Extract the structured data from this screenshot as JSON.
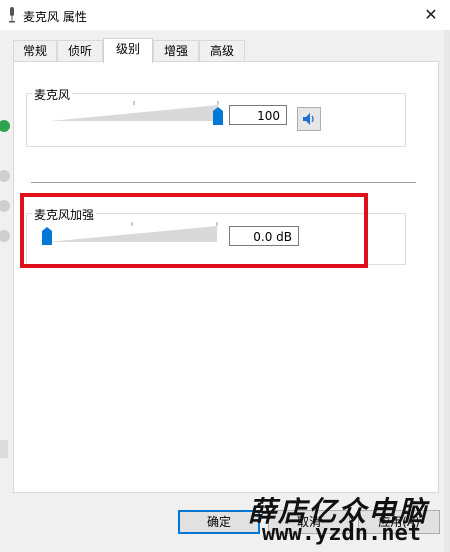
{
  "window": {
    "title": "麦克风 属性",
    "close_glyph": "✕"
  },
  "tabs": [
    {
      "label": "常规"
    },
    {
      "label": "侦听"
    },
    {
      "label": "级别"
    },
    {
      "label": "增强"
    },
    {
      "label": "高级"
    }
  ],
  "active_tab_index": 2,
  "microphone": {
    "label": "麦克风",
    "value": "100",
    "level": 1.0
  },
  "boost": {
    "label": "麦克风加强",
    "value": "0.0 dB",
    "level": 0.0
  },
  "buttons": {
    "ok": "确定",
    "cancel": "取消",
    "apply": "应用(A)"
  },
  "watermark": {
    "text": "薛店亿众电脑",
    "url": "www.yzdn.net"
  },
  "colors": {
    "accent": "#0078d7",
    "highlight": "#e0101b"
  }
}
